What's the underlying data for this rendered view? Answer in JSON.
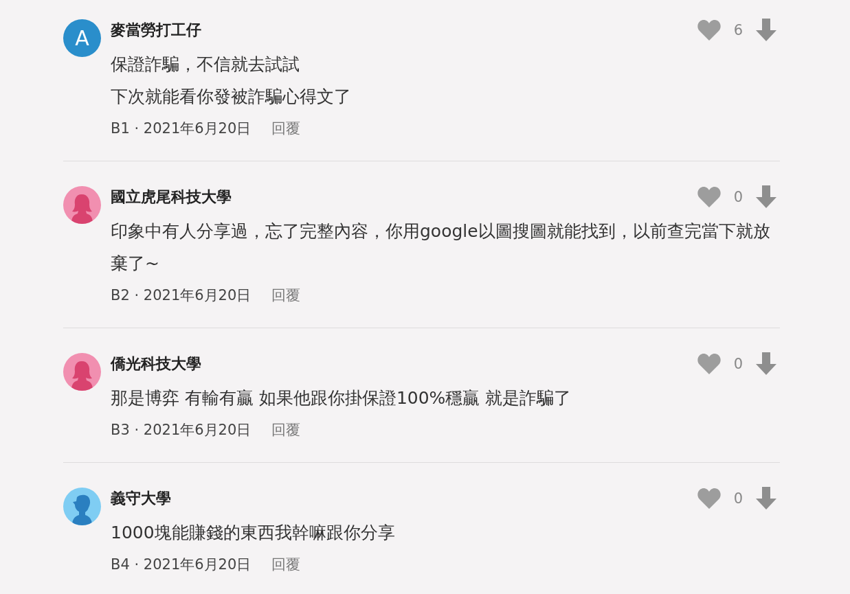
{
  "comments": [
    {
      "avatar": {
        "kind": "letter",
        "letter": "A",
        "color": "#2a8ecb"
      },
      "author": "麥當勞打工仔",
      "likes": "6",
      "lines": [
        "保證詐騙，不信就去試試",
        "下次就能看你發被詐騙心得文了"
      ],
      "meta": "B1 · 2021年6月20日",
      "reply": "回覆"
    },
    {
      "avatar": {
        "kind": "female",
        "color": "#f18fb0"
      },
      "author": "國立虎尾科技大學",
      "likes": "0",
      "lines": [
        "印象中有人分享過，忘了完整內容，你用google以圖搜圖就能找到，以前查完當下就放棄了~"
      ],
      "meta": "B2 · 2021年6月20日",
      "reply": "回覆"
    },
    {
      "avatar": {
        "kind": "female",
        "color": "#f18fb0"
      },
      "author": "僑光科技大學",
      "likes": "0",
      "lines": [
        "那是博弈 有輸有贏 如果他跟你掛保證100%穩贏 就是詐騙了"
      ],
      "meta": "B3 · 2021年6月20日",
      "reply": "回覆"
    },
    {
      "avatar": {
        "kind": "male",
        "color": "#7fcdf3"
      },
      "author": "義守大學",
      "likes": "0",
      "lines": [
        "1000塊能賺錢的東西我幹嘛跟你分享"
      ],
      "meta": "B4 · 2021年6月20日",
      "reply": "回覆"
    }
  ]
}
